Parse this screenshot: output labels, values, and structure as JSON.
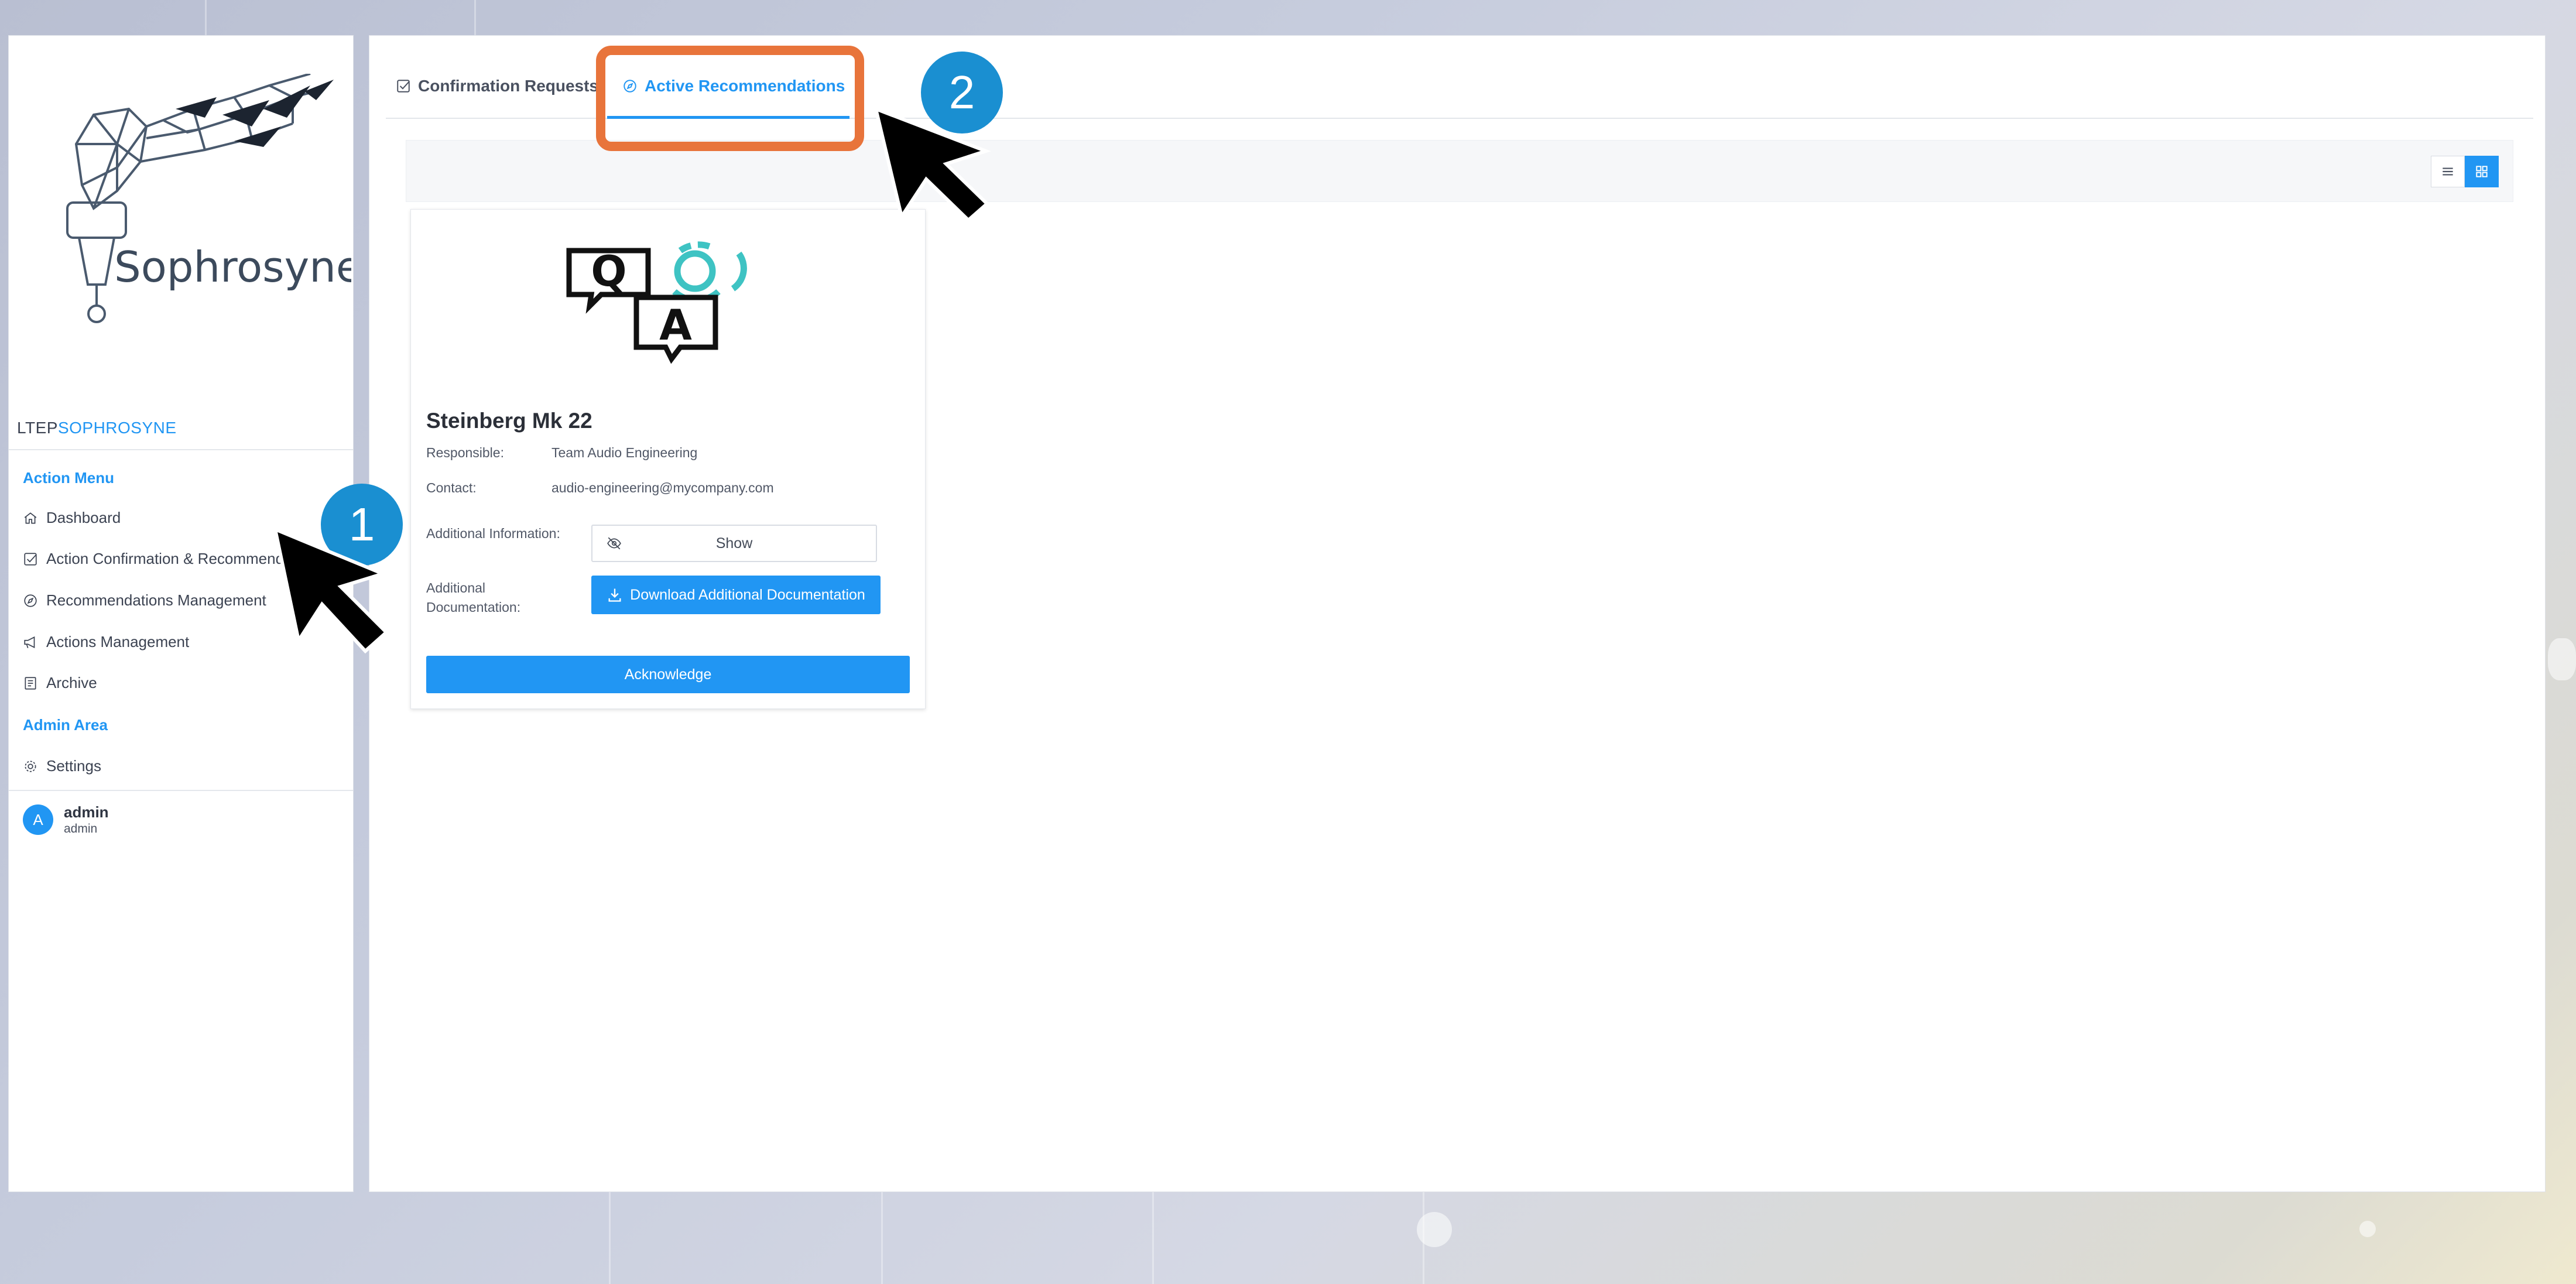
{
  "sidebar": {
    "brand_prefix": "LTEP",
    "brand_accent": "SOPHROSYNE",
    "logo_text": "Sophrosyne",
    "action_menu_heading": "Action Menu",
    "items": [
      {
        "label": "Dashboard",
        "icon": "home-icon"
      },
      {
        "label": "Action Confirmation & Recommendation",
        "icon": "checkbox-icon"
      },
      {
        "label": "Recommendations Management",
        "icon": "compass-icon"
      },
      {
        "label": "Actions Management",
        "icon": "megaphone-icon"
      },
      {
        "label": "Archive",
        "icon": "archive-icon"
      }
    ],
    "admin_heading": "Admin Area",
    "settings_label": "Settings",
    "user": {
      "initial": "A",
      "name": "admin",
      "role": "admin"
    }
  },
  "tabs": [
    {
      "label": "Confirmation Requests",
      "icon": "checkbox-icon",
      "active": false
    },
    {
      "label": "Active Recommendations",
      "icon": "compass-icon",
      "active": true
    }
  ],
  "card": {
    "title": "Steinberg Mk 22",
    "responsible_label": "Responsible:",
    "responsible_value": "Team Audio Engineering",
    "contact_label": "Contact:",
    "contact_value": "audio-engineering@mycompany.com",
    "additional_info_label": "Additional Information:",
    "show_label": "Show",
    "additional_doc_label_1": "Additional",
    "additional_doc_label_2": "Documentation:",
    "download_label": "Download Additional Documentation",
    "acknowledge_label": "Acknowledge",
    "image_letters": [
      "Q",
      "A"
    ]
  },
  "annotations": [
    {
      "number": "1"
    },
    {
      "number": "2"
    }
  ],
  "colors": {
    "accent": "#2196f3",
    "highlight": "#e8743b",
    "badge": "#1a8fd1"
  }
}
